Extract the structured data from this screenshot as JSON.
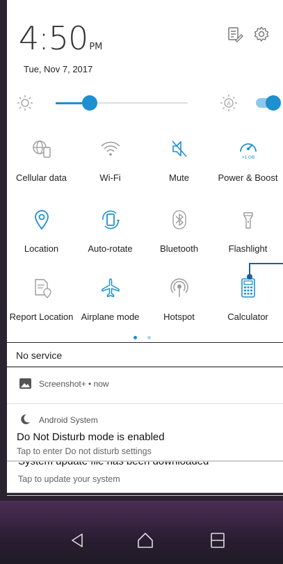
{
  "header": {
    "time": "4:50",
    "ampm": "PM",
    "date": "Tue, Nov 7, 2017",
    "edit_icon": "edit-notes-icon",
    "settings_icon": "gear-icon"
  },
  "brightness": {
    "level": 0.26,
    "auto": true
  },
  "tiles": [
    {
      "label": "Cellular data",
      "icon": "globe-phone-icon",
      "active": false
    },
    {
      "label": "Wi-Fi",
      "icon": "wifi-icon",
      "active": false
    },
    {
      "label": "Mute",
      "icon": "mute-icon",
      "active": true
    },
    {
      "label": "Power & Boost",
      "icon": "boost-gauge-icon",
      "active": true,
      "badge": ">1 GB"
    },
    {
      "label": "Location",
      "icon": "location-pin-icon",
      "active": true
    },
    {
      "label": "Auto-rotate",
      "icon": "auto-rotate-icon",
      "active": true
    },
    {
      "label": "Bluetooth",
      "icon": "bluetooth-icon",
      "active": false
    },
    {
      "label": "Flashlight",
      "icon": "flashlight-icon",
      "active": false
    },
    {
      "label": "Report Location",
      "icon": "report-location-icon",
      "active": false
    },
    {
      "label": "Airplane mode",
      "icon": "airplane-icon",
      "active": true
    },
    {
      "label": "Hotspot",
      "icon": "hotspot-icon",
      "active": false
    },
    {
      "label": "Calculator",
      "icon": "calculator-icon",
      "active": true
    }
  ],
  "page_indicator": {
    "count": 2,
    "current": 1
  },
  "status": {
    "no_service": "No service"
  },
  "notifications": [
    {
      "app": "Screenshot+ • now"
    },
    {
      "app": "Android System",
      "title": "Do Not Disturb mode is enabled",
      "subtitle": "Tap to enter Do not disturb settings"
    },
    {
      "title": "System update file has been downloaded",
      "subtitle": "Tap to update your system"
    }
  ],
  "colors": {
    "accent": "#1e8fcf",
    "inactive_icon": "#9a9a9a",
    "callout": "#1f5f9a"
  },
  "navigation": {
    "back_icon": "back-triangle-icon",
    "home_icon": "home-icon",
    "recents_icon": "recents-icon"
  }
}
